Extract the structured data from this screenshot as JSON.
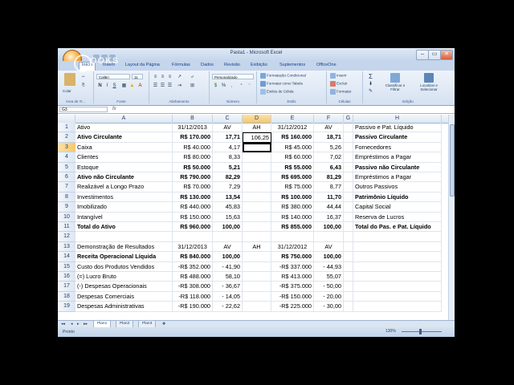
{
  "window": {
    "title": "Pasta1 - Microsoft Excel",
    "buttons": [
      "–",
      "▭",
      "✕"
    ]
  },
  "tabs": [
    "Início",
    "Inserir",
    "Layout da Página",
    "Fórmulas",
    "Dados",
    "Revisão",
    "Exibição",
    "Suplementos",
    "OfficeOne"
  ],
  "ribbon": {
    "clipboard": {
      "label": "Área de Tr...",
      "paste": "Colar"
    },
    "font": {
      "label": "Fonte",
      "name": "Calibri",
      "size": "11",
      "bold": "N",
      "italic": "I",
      "underline": "S"
    },
    "alignment": {
      "label": "Alinhamento"
    },
    "number": {
      "label": "Número",
      "format": "Personalizado"
    },
    "styles": {
      "label": "Estilo",
      "items": [
        "Formatação Condicional",
        "Formatar como Tabela",
        "Estilos de Célula"
      ]
    },
    "cells": {
      "label": "Células",
      "items": [
        "Inserir",
        "Excluir",
        "Formatar"
      ]
    },
    "editing": {
      "label": "Edição",
      "items": [
        "Classificar e Filtrar",
        "Localizar e Selecionar"
      ]
    }
  },
  "formula_bar": {
    "namebox": "G3",
    "fx": "fx",
    "content": ""
  },
  "columns": {
    "A": "A",
    "B": "B",
    "C": "C",
    "D": "D",
    "E": "E",
    "F": "F",
    "G": "G",
    "H": "H"
  },
  "rows": [
    {
      "n": "1",
      "A": "Ativo",
      "B": "31/12/2013",
      "C": "AV",
      "D": "AH",
      "E": "31/12/2012",
      "F": "AV",
      "G": "",
      "H": "Passivo e Pat. Líquido"
    },
    {
      "n": "2",
      "A": "Ativo Circulante",
      "B": "R$ 170.000",
      "C": "17,71",
      "D": "106,25",
      "E": "R$ 160.000",
      "F": "18,71",
      "G": "",
      "H": "Passivo Circulante"
    },
    {
      "n": "3",
      "A": "Caixa",
      "B": "R$ 40.000",
      "C": "4,17",
      "D": "",
      "E": "R$ 45.000",
      "F": "5,26",
      "G": "",
      "H": "Fornecedores"
    },
    {
      "n": "4",
      "A": "Clientes",
      "B": "R$ 80.000",
      "C": "8,33",
      "D": "",
      "E": "R$ 60.000",
      "F": "7,02",
      "G": "",
      "H": "Empréstimos a Pagar"
    },
    {
      "n": "5",
      "A": "Estoque",
      "B": "R$ 50.000",
      "C": "5,21",
      "D": "",
      "E": "R$ 55.000",
      "F": "6,43",
      "G": "",
      "H": "Passivo não Circulante"
    },
    {
      "n": "6",
      "A": "Ativo não Circulante",
      "B": "R$ 790.000",
      "C": "82,29",
      "D": "",
      "E": "R$ 695.000",
      "F": "81,29",
      "G": "",
      "H": "Empréstimos a Pagar"
    },
    {
      "n": "7",
      "A": "Realizável a Longo Prazo",
      "B": "R$ 70.000",
      "C": "7,29",
      "D": "",
      "E": "R$ 75.000",
      "F": "8,77",
      "G": "",
      "H": "Outros Passivos"
    },
    {
      "n": "8",
      "A": "Investimentos",
      "B": "R$ 130.000",
      "C": "13,54",
      "D": "",
      "E": "R$ 100.000",
      "F": "11,70",
      "G": "",
      "H": "Patrimônio Líquido"
    },
    {
      "n": "9",
      "A": "Imobilizado",
      "B": "R$ 440.000",
      "C": "45,83",
      "D": "",
      "E": "R$ 380.000",
      "F": "44,44",
      "G": "",
      "H": "Capital Social"
    },
    {
      "n": "10",
      "A": "Intangível",
      "B": "R$ 150.000",
      "C": "15,63",
      "D": "",
      "E": "R$ 140.000",
      "F": "16,37",
      "G": "",
      "H": "Reserva de Lucros"
    },
    {
      "n": "11",
      "A": "Total do Ativo",
      "B": "R$ 960.000",
      "C": "100,00",
      "D": "",
      "E": "R$ 855.000",
      "F": "100,00",
      "G": "",
      "H": "Total do Pas. e Pat. Líquido"
    },
    {
      "n": "12",
      "A": "",
      "B": "",
      "C": "",
      "D": "",
      "E": "",
      "F": "",
      "G": "",
      "H": ""
    },
    {
      "n": "13",
      "A": "Demonstração de Resultados",
      "B": "31/12/2013",
      "C": "AV",
      "D": "AH",
      "E": "31/12/2012",
      "F": "AV",
      "G": "",
      "H": ""
    },
    {
      "n": "14",
      "A": "Receita Operacional Líquida",
      "B": "R$ 840.000",
      "C": "100,00",
      "D": "",
      "E": "R$ 750.000",
      "F": "100,00",
      "G": "",
      "H": ""
    },
    {
      "n": "15",
      "A": "Custo dos Produtos Vendidos",
      "B": "-R$ 352.000",
      "C": "- 41,90",
      "D": "",
      "E": "-R$ 337.000",
      "F": "- 44,93",
      "G": "",
      "H": ""
    },
    {
      "n": "16",
      "A": "(=) Lucro Bruto",
      "B": "R$ 488.000",
      "C": "58,10",
      "D": "",
      "E": "R$ 413.000",
      "F": "55,07",
      "G": "",
      "H": ""
    },
    {
      "n": "17",
      "A": "(-) Despesas Operacionais",
      "B": "-R$ 308.000",
      "C": "- 36,67",
      "D": "",
      "E": "-R$ 375.000",
      "F": "- 50,00",
      "G": "",
      "H": ""
    },
    {
      "n": "18",
      "A": "Despesas Comerciais",
      "B": "-R$ 118.000",
      "C": "- 14,05",
      "D": "",
      "E": "-R$ 150.000",
      "F": "- 20,00",
      "G": "",
      "H": ""
    },
    {
      "n": "19",
      "A": "Despesas Administrativas",
      "B": "-R$ 190.000",
      "C": "- 22,62",
      "D": "",
      "E": "-R$ 225.000",
      "F": "- 30,00",
      "G": "",
      "H": ""
    }
  ],
  "sheets": {
    "items": [
      "Plan1",
      "Plan2",
      "Plan3"
    ],
    "active": "Plan1"
  },
  "status": {
    "text": "Pronto",
    "zoom": "130%"
  },
  "watermark": "OOKS"
}
